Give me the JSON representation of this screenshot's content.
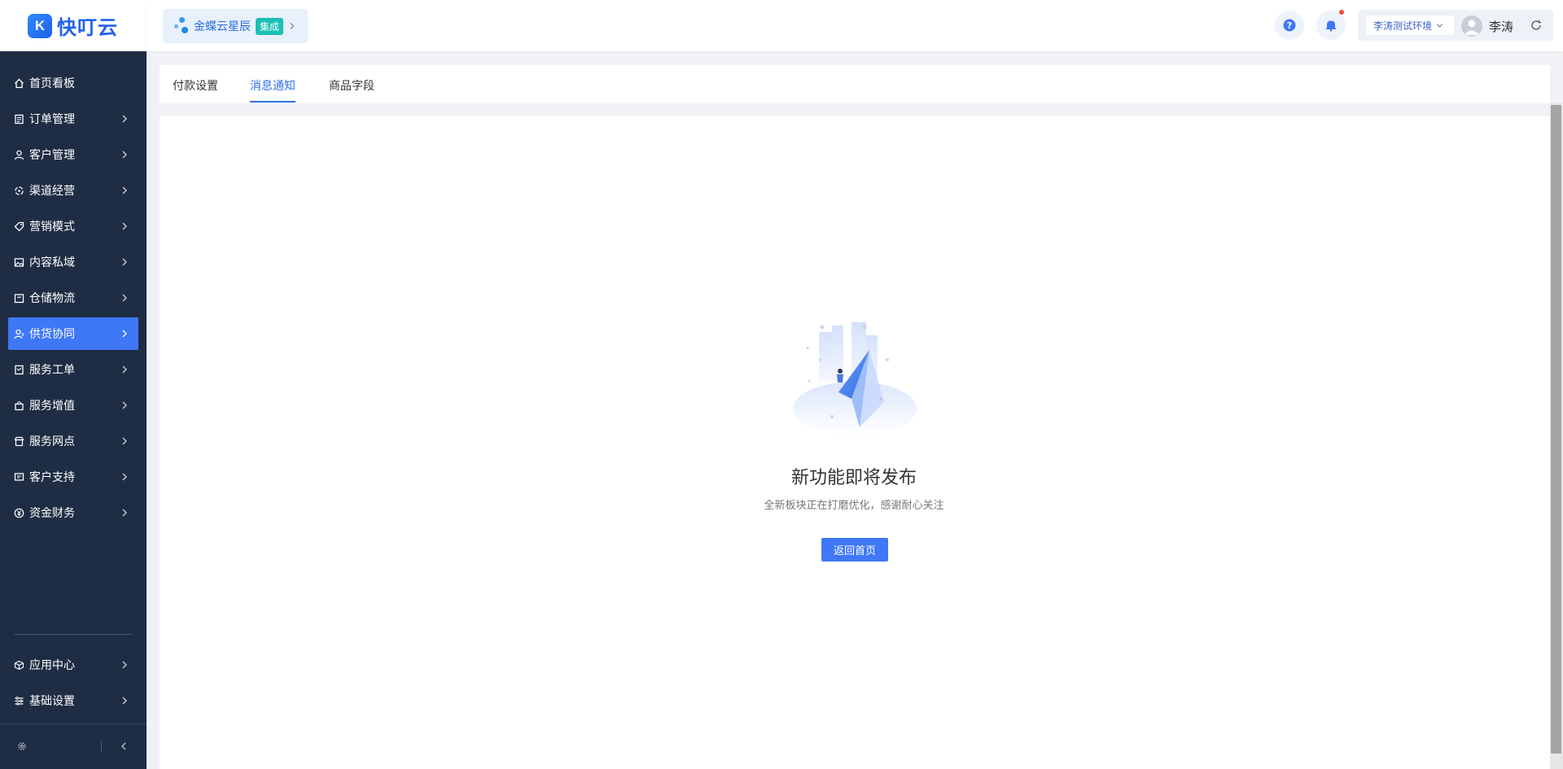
{
  "brand": {
    "name": "快叮云"
  },
  "integration": {
    "label": "金蝶云星辰",
    "badge": "集成"
  },
  "header": {
    "env": "李涛测试环境",
    "user_name": "李涛"
  },
  "sidebar": {
    "items": [
      {
        "label": "首页看板",
        "icon": "home-icon",
        "has_arrow": false
      },
      {
        "label": "订单管理",
        "icon": "order-icon",
        "has_arrow": true
      },
      {
        "label": "客户管理",
        "icon": "user-icon",
        "has_arrow": true
      },
      {
        "label": "渠道经营",
        "icon": "channel-icon",
        "has_arrow": true
      },
      {
        "label": "营销模式",
        "icon": "tag-icon",
        "has_arrow": true
      },
      {
        "label": "内容私域",
        "icon": "image-icon",
        "has_arrow": true
      },
      {
        "label": "仓储物流",
        "icon": "box-icon",
        "has_arrow": true
      },
      {
        "label": "供货协同",
        "icon": "supply-icon",
        "has_arrow": true,
        "active": true
      },
      {
        "label": "服务工单",
        "icon": "ticket-icon",
        "has_arrow": true
      },
      {
        "label": "服务增值",
        "icon": "bag-icon",
        "has_arrow": true
      },
      {
        "label": "服务网点",
        "icon": "store-icon",
        "has_arrow": true
      },
      {
        "label": "客户支持",
        "icon": "support-icon",
        "has_arrow": true
      },
      {
        "label": "资金财务",
        "icon": "yuan-icon",
        "has_arrow": true
      }
    ],
    "bottom_items": [
      {
        "label": "应用中心",
        "icon": "cube-icon",
        "has_arrow": true
      },
      {
        "label": "基础设置",
        "icon": "settings-list-icon",
        "has_arrow": true
      }
    ]
  },
  "tabs": [
    {
      "label": "付款设置"
    },
    {
      "label": "消息通知",
      "active": true
    },
    {
      "label": "商品字段"
    }
  ],
  "empty_state": {
    "title": "新功能即将发布",
    "subtitle": "全新板块正在打磨优化，感谢耐心关注",
    "button": "返回首页"
  },
  "colors": {
    "sidebar_bg": "#1f2d44",
    "accent": "#3f78f6",
    "badge": "#19c1b4"
  }
}
